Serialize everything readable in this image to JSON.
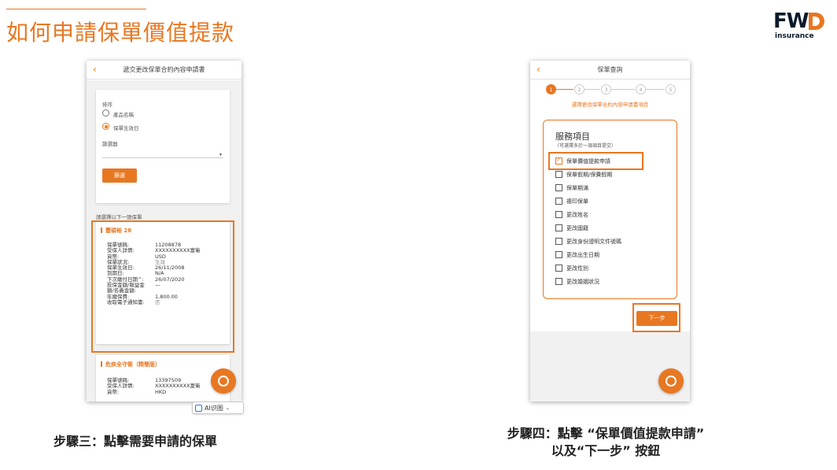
{
  "slide": {
    "title": "如何申請保單價值提款",
    "logo_word": "FW",
    "logo_sub": "insurance",
    "caption_left": "步驟三：點擊需要申請的保單",
    "caption_right_line1": "步驟四：點擊 “保單價值提款申請”",
    "caption_right_line2": "以及“下一步” 按鈕",
    "accent_color": "#e87722"
  },
  "left_screen": {
    "back_icon": "‹",
    "title": "遞交更改保單合約內容申請書",
    "sort_label": "排序",
    "sort_options": [
      {
        "label": "產品名稱",
        "selected": false
      },
      {
        "label": "保單生效日",
        "selected": true
      }
    ],
    "filter_label": "篩選器",
    "filter_button": "篩選",
    "choose_label": "請選擇以下一張保單",
    "policy1": {
      "name": "豐碩裕 28",
      "rows": [
        {
          "k": "保單號碼:",
          "v": "11208878"
        },
        {
          "k": "受保人詳情:",
          "v": "XXXXXXXXXX富衛"
        },
        {
          "k": "貨幣:",
          "v": "USD"
        },
        {
          "k": "保單狀況:",
          "v": "生效"
        },
        {
          "k": "保單生效日:",
          "v": "26/11/2008"
        },
        {
          "k": "到期日:",
          "v": "N/A"
        },
        {
          "k": "下次繳付日期^:",
          "v": "26/07/2020"
        },
        {
          "k": "投保金額/報益金",
          "v": "—"
        },
        {
          "k": "額/名義金額:",
          "v": ""
        },
        {
          "k": "年繳保費:",
          "v": "1,800.00"
        },
        {
          "k": "收取電子通知書:",
          "v": "否"
        }
      ]
    },
    "policy2": {
      "name": "危疾全守衛（精簡版）",
      "rows": [
        {
          "k": "保單號碼:",
          "v": "13397509"
        },
        {
          "k": "受保人詳情:",
          "v": "XXXXXXXXXX富衛"
        },
        {
          "k": "貨幣:",
          "v": "HKD"
        }
      ]
    },
    "ai_badge": "AI识图"
  },
  "right_screen": {
    "back_icon": "‹",
    "title": "保單查詢",
    "steps": [
      "1",
      "2",
      "3",
      "4",
      "5"
    ],
    "step_caption": "選擇更改保單合約內容申請書項目",
    "service_title": "服務項目",
    "service_hint": "（可選擇多於一項項目提交）",
    "options": [
      {
        "label": "保單價值提款申請",
        "checked": true
      },
      {
        "label": "保單假期/保費假期",
        "checked": false
      },
      {
        "label": "保單期滿",
        "checked": false
      },
      {
        "label": "複印保單",
        "checked": false
      },
      {
        "label": "更改姓名",
        "checked": false
      },
      {
        "label": "更改國籍",
        "checked": false
      },
      {
        "label": "更改身份證明文件號碼",
        "checked": false
      },
      {
        "label": "更改出生日期",
        "checked": false
      },
      {
        "label": "更改性別",
        "checked": false
      },
      {
        "label": "更改婚姻狀況",
        "checked": false
      }
    ],
    "next_button": "下一步"
  }
}
